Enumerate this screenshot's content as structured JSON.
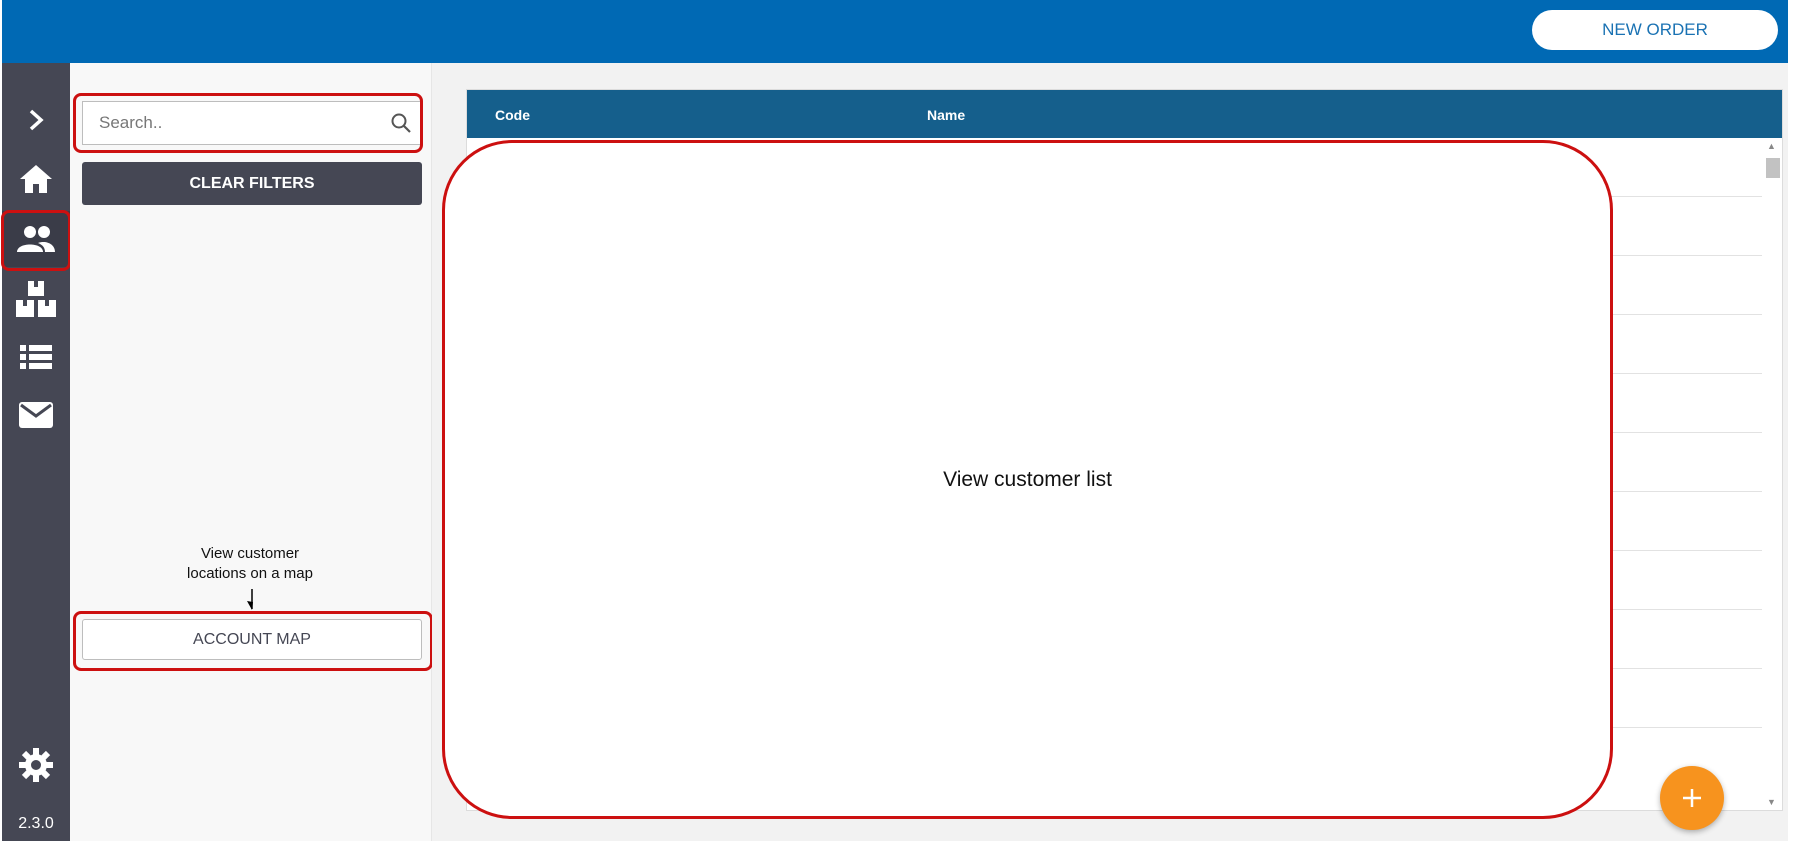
{
  "header": {
    "new_order_label": "NEW ORDER"
  },
  "sidebar": {
    "items": [
      {
        "icon": "chevron-right-icon"
      },
      {
        "icon": "home-icon"
      },
      {
        "icon": "people-icon",
        "active": true
      },
      {
        "icon": "boxes-icon"
      },
      {
        "icon": "list-icon"
      },
      {
        "icon": "mail-icon"
      },
      {
        "icon": "gear-icon"
      }
    ],
    "version": "2.3.0"
  },
  "filters": {
    "search_placeholder": "Search..",
    "clear_filters_label": "CLEAR FILTERS",
    "map_note": "View customer locations on a map",
    "account_map_label": "ACCOUNT MAP"
  },
  "table": {
    "columns": [
      "Code",
      "Name"
    ],
    "overlay_text": "View customer list"
  },
  "colors": {
    "header_blue": "#0069b4",
    "sidebar_dark": "#454754",
    "table_header": "#155f8c",
    "fab_orange": "#f7931e",
    "highlight_red": "#cc1010"
  }
}
